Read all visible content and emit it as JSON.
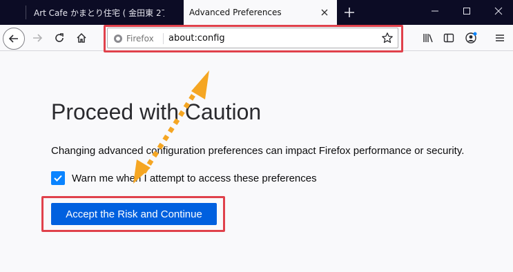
{
  "tabs": [
    {
      "label": "Art Cafe かまとり住宅 ( 金田東 2丁",
      "active": false
    },
    {
      "label": "Advanced Preferences",
      "active": true
    }
  ],
  "window_controls": {
    "minimize_icon": "minimize-icon",
    "maximize_icon": "maximize-icon",
    "close_icon": "close-icon"
  },
  "urlbar": {
    "identity_label": "Firefox",
    "url": "about:config"
  },
  "page": {
    "title": "Proceed with Caution",
    "description": "Changing advanced configuration preferences can impact Firefox performance or security.",
    "checkbox_label": "Warn me when I attempt to access these preferences",
    "checkbox_checked": true,
    "button_label": "Accept the Risk and Continue"
  },
  "colors": {
    "accent": "#0060df",
    "checkbox": "#0a84ff",
    "annotation_red": "#e0414b",
    "annotation_arrow": "#f5a623",
    "tabstrip_bg": "#0c0c25"
  }
}
